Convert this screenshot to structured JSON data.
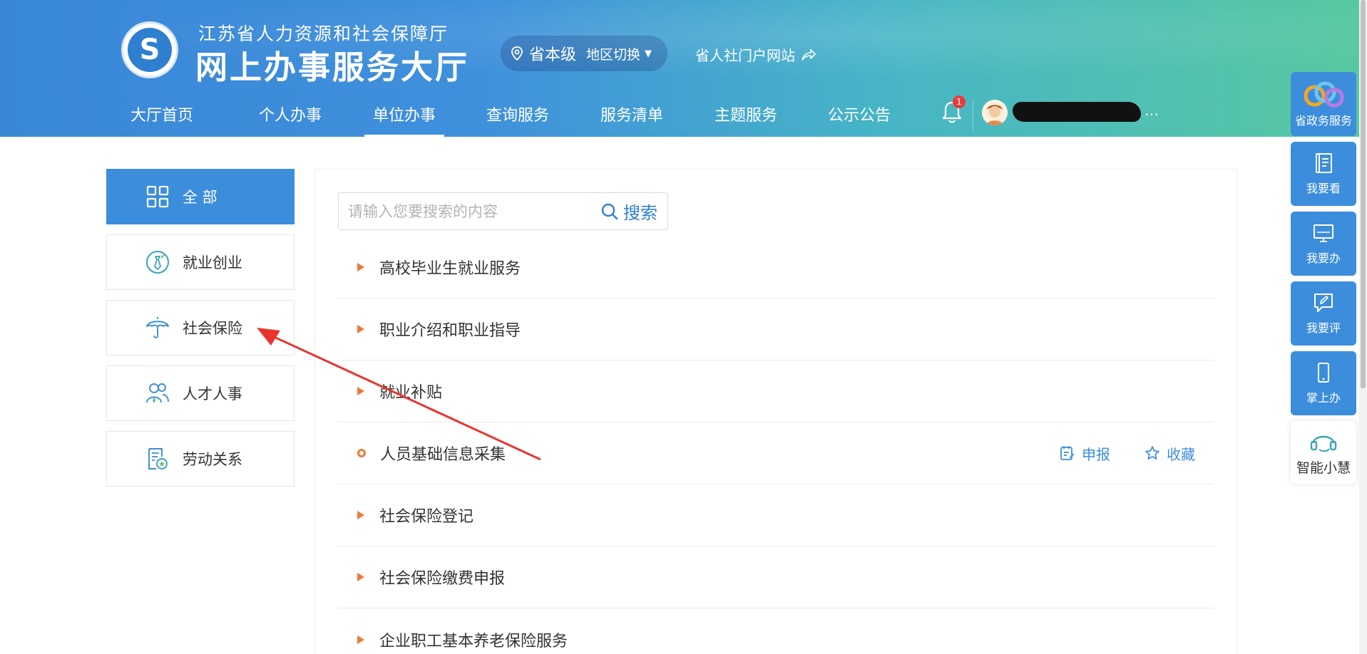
{
  "header": {
    "org_name": "江苏省人力资源和社会保障厅",
    "hall_name": "网上办事服务大厅",
    "region_level": "省本级",
    "region_switch": "地区切换",
    "portal_link": "省人社门户网站",
    "notification_count": "1",
    "user_name_suffix": "…"
  },
  "nav": {
    "items": [
      {
        "label": "大厅首页"
      },
      {
        "label": "个人办事"
      },
      {
        "label": "单位办事"
      },
      {
        "label": "查询服务"
      },
      {
        "label": "服务清单"
      },
      {
        "label": "主题服务"
      },
      {
        "label": "公示公告"
      }
    ],
    "active_index": 2
  },
  "sidebar": {
    "items": [
      {
        "label": "全 部",
        "icon": "grid-icon",
        "active": true
      },
      {
        "label": "就业创业",
        "icon": "tie-icon"
      },
      {
        "label": "社会保险",
        "icon": "umbrella-icon"
      },
      {
        "label": "人才人事",
        "icon": "people-icon"
      },
      {
        "label": "劳动关系",
        "icon": "contract-icon"
      }
    ]
  },
  "search": {
    "placeholder": "请输入您要搜索的内容",
    "button_label": "搜索"
  },
  "services": [
    {
      "label": "高校毕业生就业服务",
      "expandable": true
    },
    {
      "label": "职业介绍和职业指导",
      "expandable": true
    },
    {
      "label": "就业补贴",
      "expandable": true
    },
    {
      "label": "人员基础信息采集",
      "expandable": false,
      "actions": {
        "apply": "申报",
        "favorite": "收藏"
      }
    },
    {
      "label": "社会保险登记",
      "expandable": true
    },
    {
      "label": "社会保险缴费申报",
      "expandable": true
    },
    {
      "label": "企业职工基本养老保险服务",
      "expandable": true
    }
  ],
  "float_toolbar": [
    {
      "label": "省政务服务",
      "icon": "gov-service-logo-icon"
    },
    {
      "label": "我要看",
      "icon": "book-icon"
    },
    {
      "label": "我要办",
      "icon": "monitor-icon"
    },
    {
      "label": "我要评",
      "icon": "comment-edit-icon"
    },
    {
      "label": "掌上办",
      "icon": "phone-icon"
    },
    {
      "label": "智能小慧",
      "icon": "headset-icon"
    }
  ],
  "colors": {
    "accent": "#3c8ddc",
    "orange_marker": "#ee7a3a",
    "annotation_arrow": "#e8352e"
  }
}
